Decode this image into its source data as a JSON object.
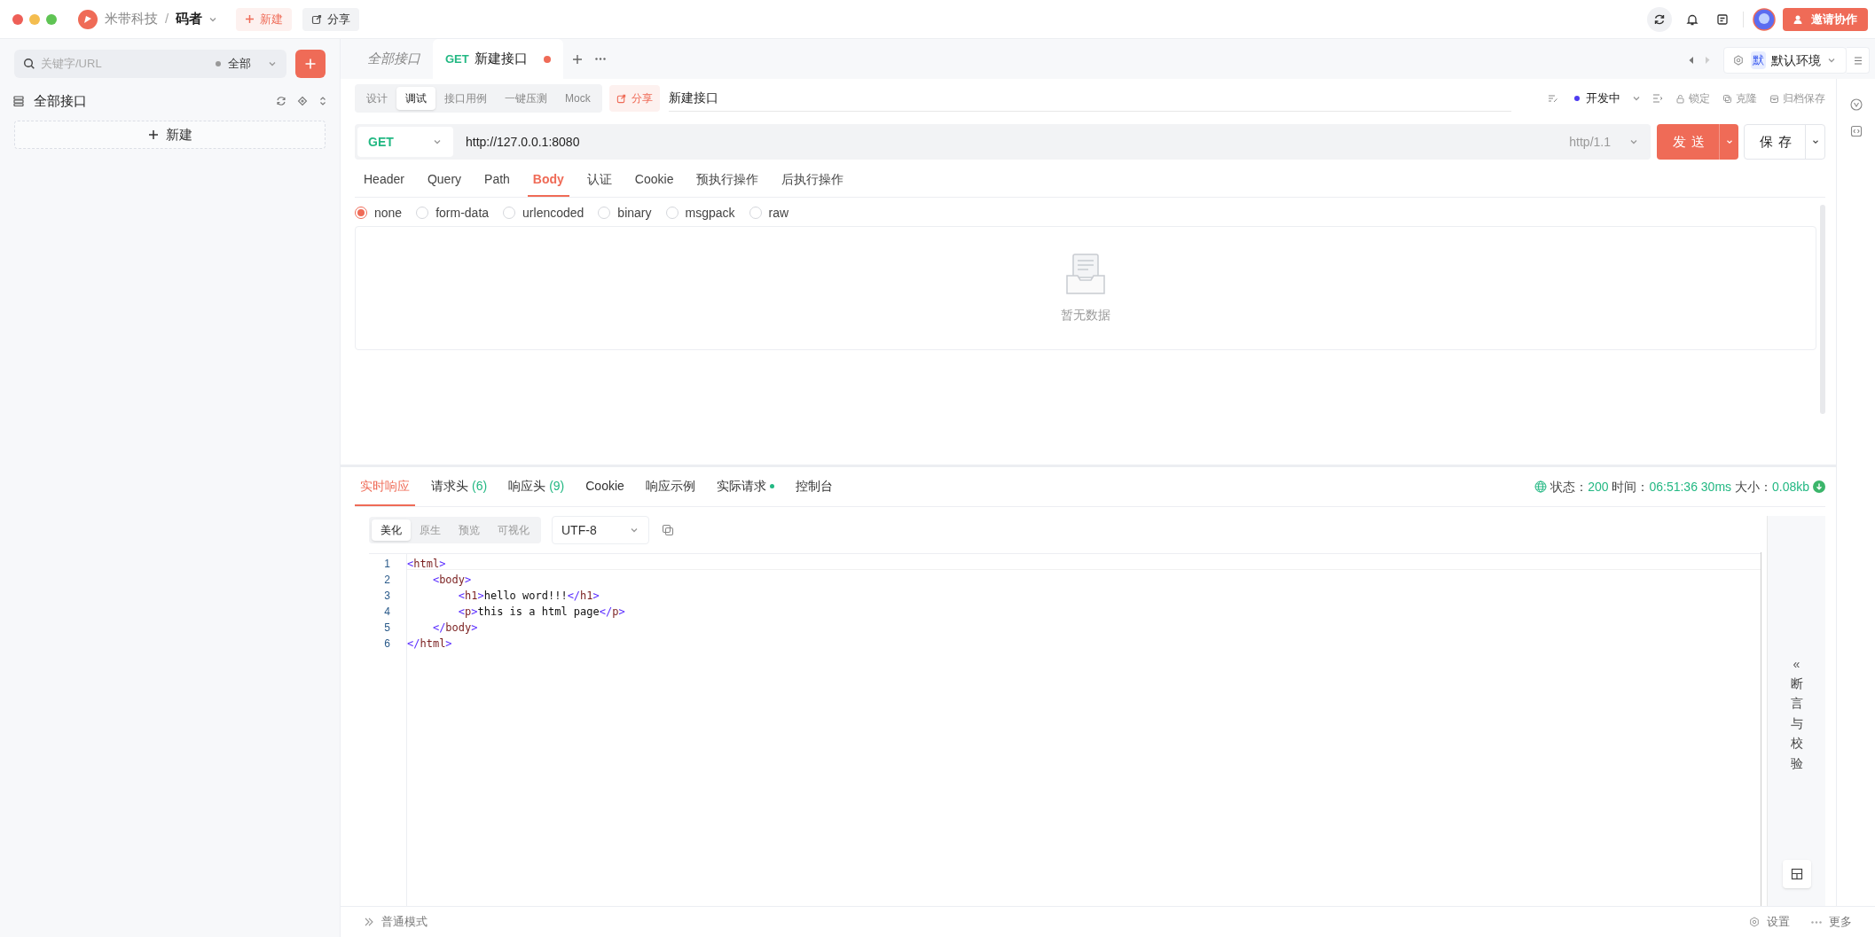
{
  "header": {
    "team": "米带科技",
    "separator": "/",
    "project": "码者",
    "new_button": "新建",
    "share_button": "分享",
    "invite_button": "邀请协作"
  },
  "sidebar": {
    "search": {
      "placeholder": "关键字/URL",
      "filter": "全部"
    },
    "tree": [
      {
        "label": "全部接口"
      }
    ],
    "new_button": "新建"
  },
  "tabs": [
    {
      "label": "全部接口",
      "selected": false,
      "unsaved": false
    },
    {
      "method": "GET",
      "label": "新建接口",
      "selected": true,
      "unsaved": true
    }
  ],
  "environment": {
    "badge": "默",
    "label": "默认环境"
  },
  "mode_tabs": [
    {
      "label": "设计",
      "selected": false
    },
    {
      "label": "调试",
      "selected": true
    },
    {
      "label": "接口用例",
      "selected": false
    },
    {
      "label": "一键压测",
      "selected": false
    },
    {
      "label": "Mock",
      "selected": false
    }
  ],
  "share_chip": "分享",
  "api_name": "新建接口",
  "api_status": {
    "label": "开发中",
    "color": "#4f3cf0"
  },
  "actions": [
    {
      "kind": "lock",
      "label": "锁定"
    },
    {
      "kind": "clone",
      "label": "克隆"
    },
    {
      "kind": "archive",
      "label": "归档保存"
    }
  ],
  "request": {
    "method": "GET",
    "url": "http://127.0.0.1:8080",
    "protocol": "http/1.1",
    "send_button": "发送",
    "save_button": "保存"
  },
  "param_tabs": [
    {
      "label": "Header",
      "selected": false
    },
    {
      "label": "Query",
      "selected": false
    },
    {
      "label": "Path",
      "selected": false
    },
    {
      "label": "Body",
      "selected": true
    },
    {
      "label": "认证",
      "selected": false
    },
    {
      "label": "Cookie",
      "selected": false
    },
    {
      "label": "预执行操作",
      "selected": false
    },
    {
      "label": "后执行操作",
      "selected": false
    }
  ],
  "body_types": [
    {
      "label": "none",
      "selected": true
    },
    {
      "label": "form-data",
      "selected": false
    },
    {
      "label": "urlencoded",
      "selected": false
    },
    {
      "label": "binary",
      "selected": false
    },
    {
      "label": "msgpack",
      "selected": false
    },
    {
      "label": "raw",
      "selected": false
    }
  ],
  "empty_text": "暂无数据",
  "response_tabs": [
    {
      "label": "实时响应",
      "selected": true,
      "dot": false
    },
    {
      "label": "请求头",
      "count": "(6)",
      "selected": false,
      "dot": false
    },
    {
      "label": "响应头",
      "count": "(9)",
      "selected": false,
      "dot": false
    },
    {
      "label": "Cookie",
      "selected": false,
      "dot": false
    },
    {
      "label": "响应示例",
      "selected": false,
      "dot": false
    },
    {
      "label": "实际请求",
      "selected": false,
      "dot": true
    },
    {
      "label": "控制台",
      "selected": false,
      "dot": false
    }
  ],
  "response_meta": {
    "status_label": "状态：",
    "status": "200",
    "time_label": "时间：",
    "time": "06:51:36",
    "duration": "30ms",
    "size_label": "大小：",
    "size": "0.08kb"
  },
  "view_modes": [
    {
      "label": "美化",
      "selected": true
    },
    {
      "label": "原生",
      "selected": false
    },
    {
      "label": "预览",
      "selected": false
    },
    {
      "label": "可视化",
      "selected": false
    }
  ],
  "encoding": "UTF-8",
  "code_lines": [
    {
      "number": "1",
      "text": "<html>"
    },
    {
      "number": "2",
      "text": "    <body>"
    },
    {
      "number": "3",
      "text": "        <h1>hello word!!!</h1>"
    },
    {
      "number": "4",
      "text": "        <p>this is a html page</p>"
    },
    {
      "number": "5",
      "text": "    </body>"
    },
    {
      "number": "6",
      "text": "</html>"
    }
  ],
  "assertion_panel": {
    "toggle": "«",
    "label": "断言与校验"
  },
  "footer": {
    "mode": "普通模式",
    "settings": "设置",
    "more": "更多"
  }
}
